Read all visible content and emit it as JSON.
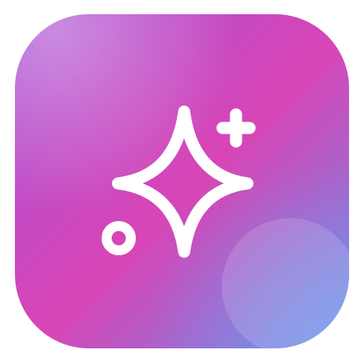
{
  "icon": {
    "name": "sparkles-app-icon",
    "glyphs": [
      "four-point-star-icon",
      "plus-icon",
      "circle-icon"
    ],
    "colors": {
      "gradient_top_left": "#a64fd6",
      "gradient_mid": "#d845b6",
      "gradient_bottom_right": "#6f8ae6",
      "glyph_stroke": "#ffffff",
      "highlight": "#ffffff"
    }
  }
}
